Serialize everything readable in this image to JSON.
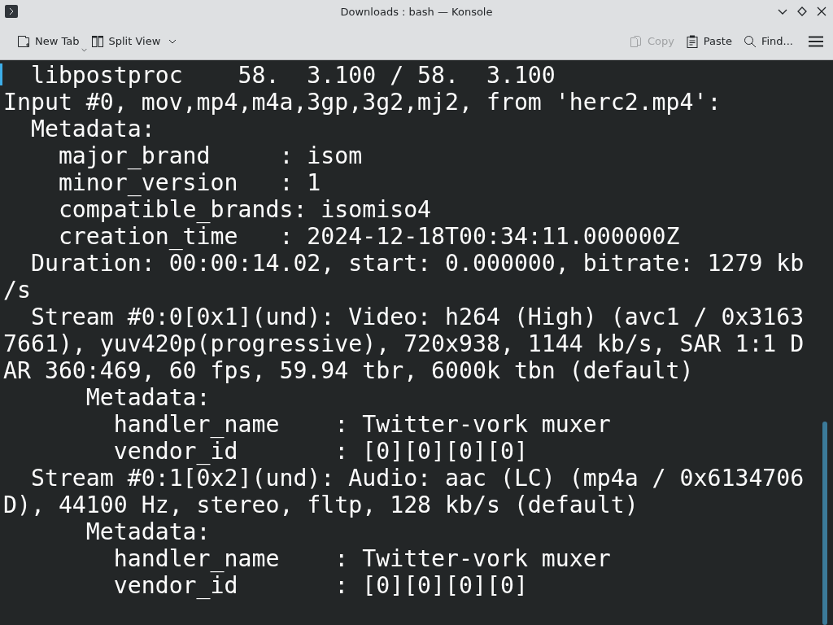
{
  "window": {
    "title": "Downloads : bash — Konsole"
  },
  "toolbar": {
    "left": [
      {
        "label": "New Tab",
        "kind": "newtab",
        "has_menu": true
      },
      {
        "label": "Split View",
        "kind": "split",
        "has_menu": true
      }
    ],
    "right": [
      {
        "label": "Copy",
        "kind": "copy",
        "disabled": true
      },
      {
        "label": "Paste",
        "kind": "paste",
        "disabled": false
      },
      {
        "label": "Find...",
        "kind": "search",
        "disabled": false
      }
    ]
  },
  "terminal": {
    "lines": [
      "  libpostproc    58.  3.100 / 58.  3.100",
      "Input #0, mov,mp4,m4a,3gp,3g2,mj2, from 'herc2.mp4':",
      "  Metadata:",
      "    major_brand     : isom",
      "    minor_version   : 1",
      "    compatible_brands: isomiso4",
      "    creation_time   : 2024-12-18T00:34:11.000000Z",
      "  Duration: 00:00:14.02, start: 0.000000, bitrate: 1279 kb",
      "/s",
      "  Stream #0:0[0x1](und): Video: h264 (High) (avc1 / 0x3163",
      "7661), yuv420p(progressive), 720x938, 1144 kb/s, SAR 1:1 D",
      "AR 360:469, 60 fps, 59.94 tbr, 6000k tbn (default)",
      "      Metadata:",
      "        handler_name    : Twitter-vork muxer",
      "        vendor_id       : [0][0][0][0]",
      "  Stream #0:1[0x2](und): Audio: aac (LC) (mp4a / 0x6134706",
      "D), 44100 Hz, stereo, fltp, 128 kb/s (default)",
      "      Metadata:",
      "        handler_name    : Twitter-vork muxer",
      "        vendor_id       : [0][0][0][0]"
    ]
  }
}
